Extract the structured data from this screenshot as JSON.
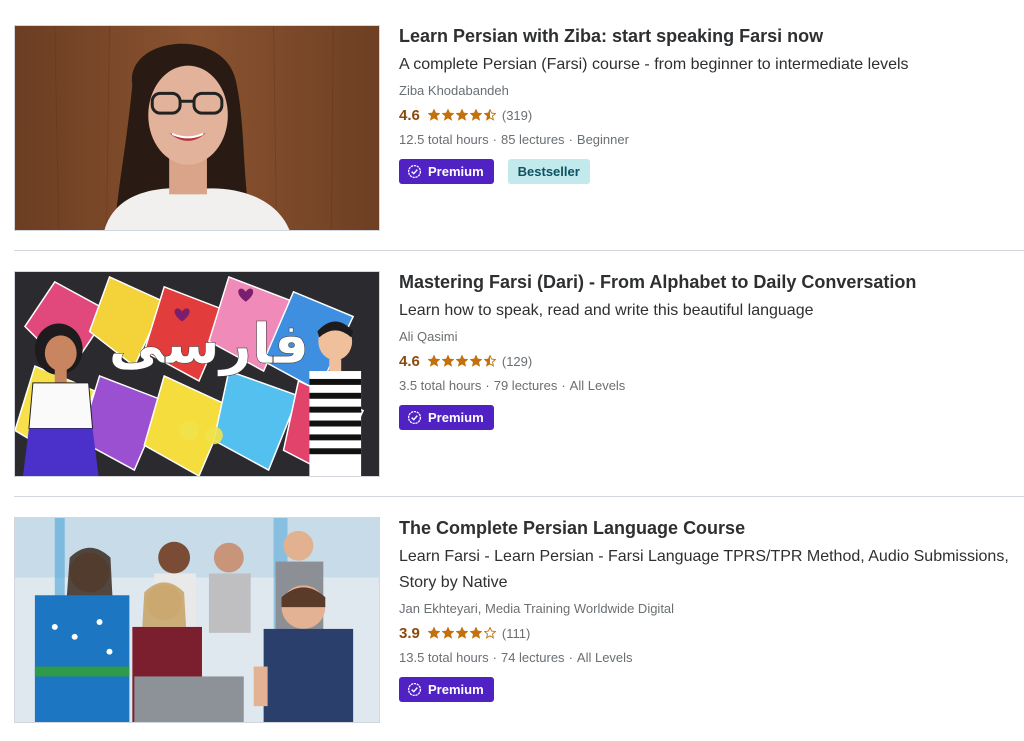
{
  "courses": [
    {
      "title": "Learn Persian with Ziba: start speaking Farsi now",
      "headline": "A complete Persian (Farsi) course - from beginner to intermediate levels",
      "instructor": "Ziba Khodabandeh",
      "rating": "4.6",
      "stars": 4.5,
      "reviews": "(319)",
      "hours": "12.5 total hours",
      "lectures": "85 lectures",
      "level": "Beginner",
      "premium_label": "Premium",
      "bestseller_label": "Bestseller",
      "thumbnail_icon": "instructor-portrait"
    },
    {
      "title": "Mastering Farsi (Dari) - From Alphabet to Daily Conversation",
      "headline": "Learn how to speak, read and write this beautiful language",
      "instructor": "Ali Qasimi",
      "rating": "4.6",
      "stars": 4.5,
      "reviews": "(129)",
      "hours": "3.5 total hours",
      "lectures": "79 lectures",
      "level": "All Levels",
      "premium_label": "Premium",
      "thumbnail_text": "فارسی",
      "thumbnail_icon": "kites-illustration"
    },
    {
      "title": "The Complete Persian Language Course",
      "headline": "Learn Farsi - Learn Persian - Farsi Language TPRS/TPR Method, Audio Submissions, Story by Native",
      "instructor": "Jan Ekhteyari, Media Training Worldwide Digital",
      "rating": "3.9",
      "stars": 4,
      "reviews": "(111)",
      "hours": "13.5 total hours",
      "lectures": "74 lectures",
      "level": "All Levels",
      "premium_label": "Premium",
      "thumbnail_icon": "group-laptop-photo"
    }
  ],
  "separator": "·",
  "colors": {
    "rating": "#8a4a0c",
    "star": "#c4710d",
    "premium_bg": "#5022c3",
    "bestseller_bg": "#c2e9eb",
    "bestseller_text": "#0d5261"
  }
}
